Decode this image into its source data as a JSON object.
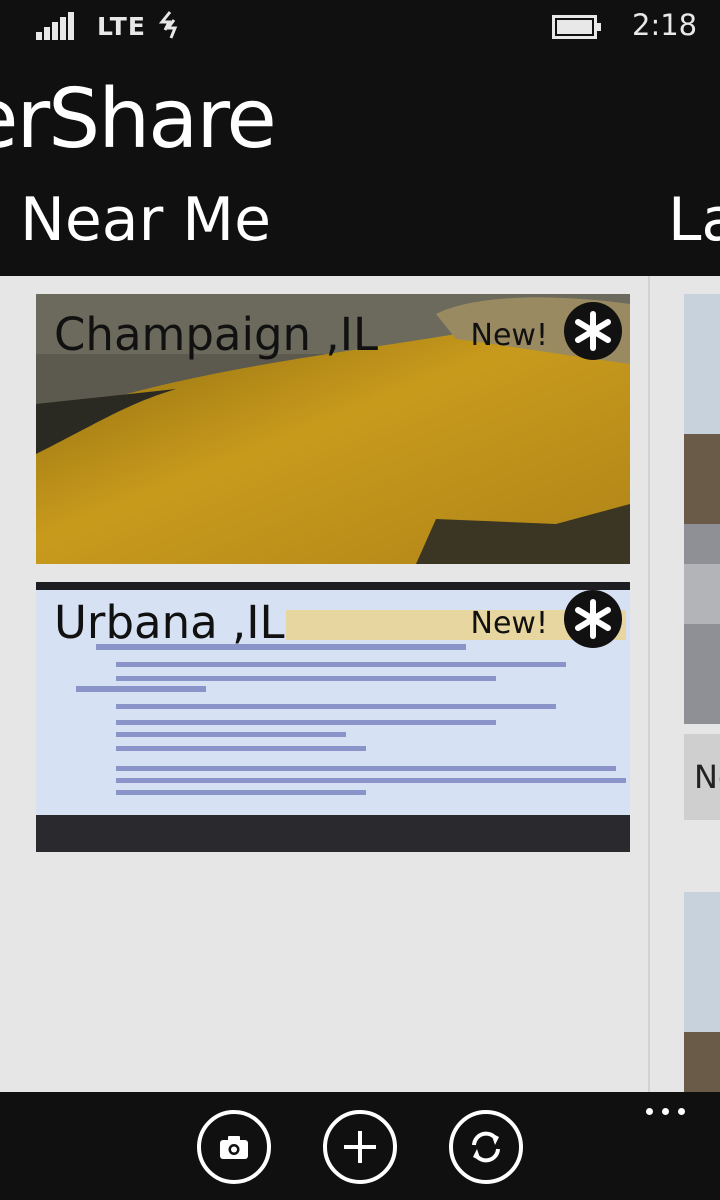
{
  "status": {
    "network": "LTE",
    "time": "2:18"
  },
  "app": {
    "title": "erShare"
  },
  "pivots": {
    "active": "Near Me",
    "next": "La"
  },
  "cards": [
    {
      "location": "Champaign ,IL",
      "badge": "New!"
    },
    {
      "location": "Urbana ,IL",
      "badge": "New!"
    }
  ],
  "side": {
    "label": "Ne"
  },
  "appbar": {
    "buttons": [
      "camera-icon",
      "add-icon",
      "refresh-icon"
    ],
    "more": "more-icon"
  },
  "colors": {
    "background": "#101010",
    "content": "#e6e6e6",
    "text_dark": "#111111"
  }
}
